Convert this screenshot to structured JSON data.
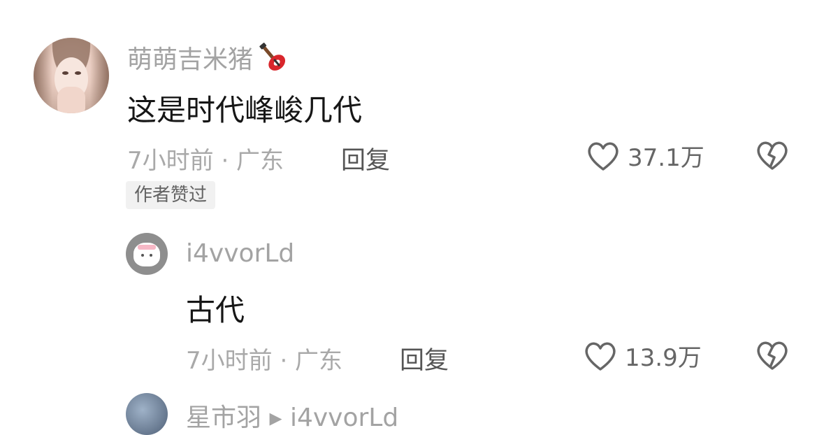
{
  "comments": [
    {
      "username": "萌萌吉米猪",
      "text": "这是时代峰峻几代",
      "meta": "7小时前 · 广东",
      "reply_label": "回复",
      "like_count": "37.1万",
      "badge": "作者赞过"
    },
    {
      "username": "i4vvorLd",
      "text": "古代",
      "meta": "7小时前 · 广东",
      "reply_label": "回复",
      "like_count": "13.9万"
    }
  ],
  "peek": {
    "text": "星市羽 ▸ i4vvorLd"
  },
  "icons": {
    "username_emoji": "guitar-icon",
    "like": "heart-outline-icon",
    "dislike": "broken-heart-icon"
  },
  "colors": {
    "username": "#a3a3a3",
    "text": "#161616",
    "meta": "#a9a9a9",
    "badge_bg": "#f1f1f1",
    "guitar_red": "#d9262c"
  }
}
